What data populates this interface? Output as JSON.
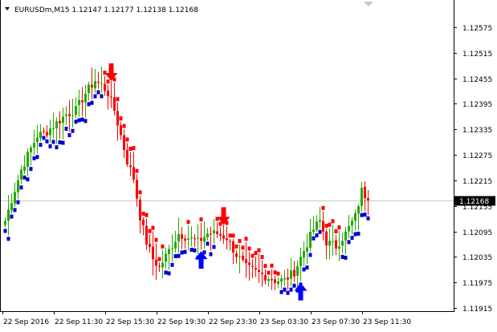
{
  "symbol_info": "EURUSDm,M15  1.12147 1.12177 1.12138 1.12168",
  "current_price_label": "1.12168",
  "icons": {
    "menu": "triangle-down-icon",
    "scroll": "triangle-down-icon"
  },
  "colors": {
    "bull": "#22aa00",
    "bear": "#ff0000",
    "trail": "#0000cc",
    "buy_arrow": "#0000ff",
    "sell_arrow": "#ff0000",
    "price_line": "#c8c8c8",
    "price_tag": "#000000"
  },
  "chart_data": {
    "type": "candlestick",
    "title": "EURUSDm,M15",
    "ohlc_text": "1.12147 1.12177 1.12138 1.12168",
    "ylim": [
      1.11915,
      1.1262
    ],
    "y_ticks": [
      "1.12575",
      "1.12515",
      "1.12455",
      "1.12395",
      "1.12335",
      "1.12275",
      "1.12215",
      "1.12155",
      "1.12095",
      "1.12035",
      "1.11975",
      "1.11915"
    ],
    "x_ticks": [
      "22 Sep 2016",
      "22 Sep 11:30",
      "22 Sep 15:30",
      "22 Sep 19:30",
      "22 Sep 23:30",
      "23 Sep 03:30",
      "23 Sep 07:30",
      "23 Sep 11:30"
    ],
    "current_price": 1.12168,
    "grid": false,
    "signals": [
      {
        "type": "sell",
        "x_index": 33
      },
      {
        "type": "buy",
        "x_index": 61
      },
      {
        "type": "sell",
        "x_index": 68
      },
      {
        "type": "buy",
        "x_index": 92
      }
    ],
    "keypoints": [
      [
        0,
        1.1212
      ],
      [
        2,
        1.1217
      ],
      [
        5,
        1.1224
      ],
      [
        8,
        1.1229
      ],
      [
        10,
        1.1232
      ],
      [
        13,
        1.1233
      ],
      [
        16,
        1.1235
      ],
      [
        19,
        1.1237
      ],
      [
        22,
        1.1238
      ],
      [
        25,
        1.1242
      ],
      [
        28,
        1.1245
      ],
      [
        30,
        1.1244
      ],
      [
        32,
        1.1242
      ],
      [
        34,
        1.1238
      ],
      [
        36,
        1.1232
      ],
      [
        38,
        1.1226
      ],
      [
        40,
        1.1222
      ],
      [
        42,
        1.1213
      ],
      [
        44,
        1.1207
      ],
      [
        46,
        1.1203
      ],
      [
        48,
        1.1201
      ],
      [
        51,
        1.1205
      ],
      [
        54,
        1.1209
      ],
      [
        57,
        1.1208
      ],
      [
        60,
        1.1207
      ],
      [
        63,
        1.1209
      ],
      [
        66,
        1.1209
      ],
      [
        69,
        1.1208
      ],
      [
        72,
        1.1204
      ],
      [
        75,
        1.1201
      ],
      [
        78,
        1.12
      ],
      [
        81,
        1.1199
      ],
      [
        84,
        1.1198
      ],
      [
        87,
        1.1198
      ],
      [
        90,
        1.12
      ],
      [
        93,
        1.1205
      ],
      [
        96,
        1.121
      ],
      [
        98,
        1.1212
      ],
      [
        100,
        1.1207
      ],
      [
        103,
        1.1206
      ],
      [
        106,
        1.1209
      ],
      [
        109,
        1.1213
      ],
      [
        111,
        1.1219
      ],
      [
        113,
        1.1217
      ]
    ]
  }
}
